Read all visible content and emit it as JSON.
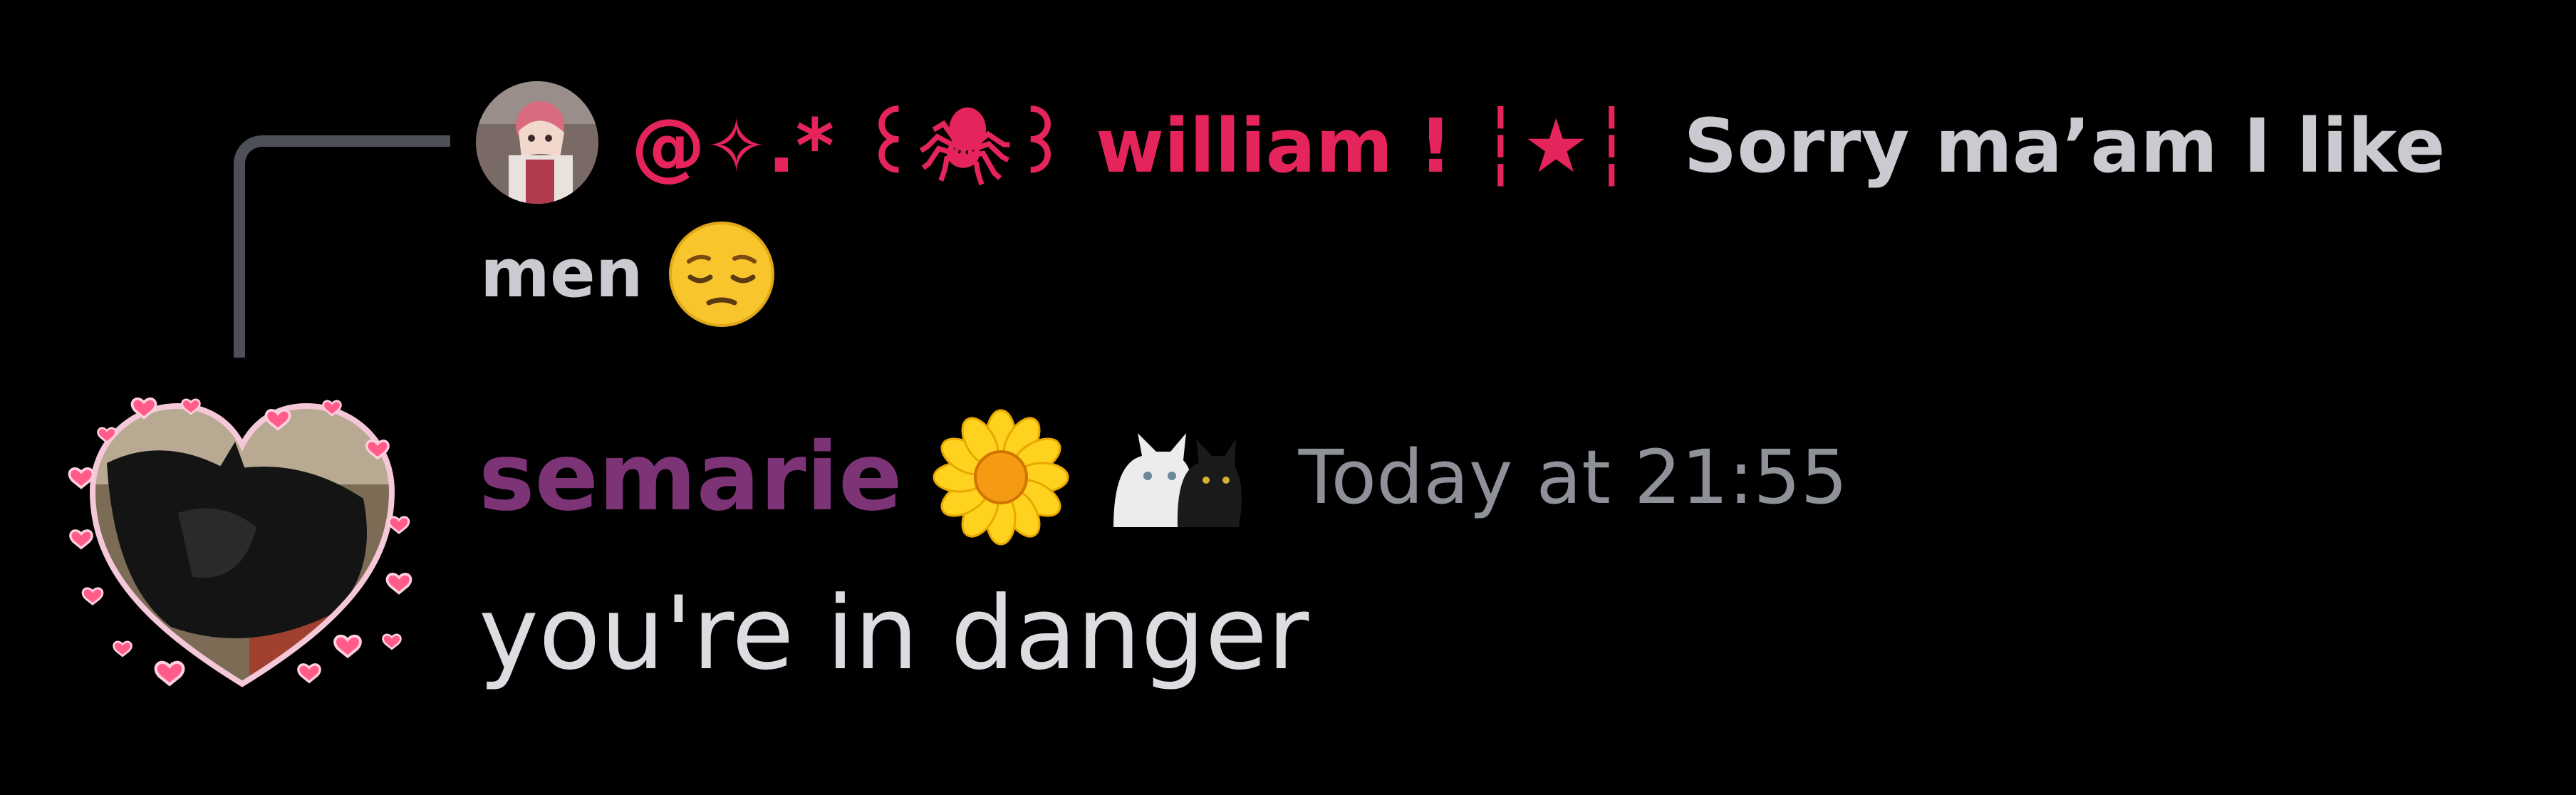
{
  "reply": {
    "author": "@✧.*  ꒰🕷꒱ william ! ┆★┆",
    "content": "Sorry ma’am I like",
    "content_cont": "men",
    "emoji": "pensive-face"
  },
  "message": {
    "author": "semarie",
    "badges": [
      "sunflower-icon",
      "cats-icon"
    ],
    "timestamp": "Today at 21:55",
    "text": "you're in danger"
  },
  "colors": {
    "background": "#000000",
    "reply_author": "#e6245c",
    "author": "#7d3477",
    "timestamp": "#8f9198",
    "text": "#dcdde1",
    "spine": "#4e5058"
  }
}
